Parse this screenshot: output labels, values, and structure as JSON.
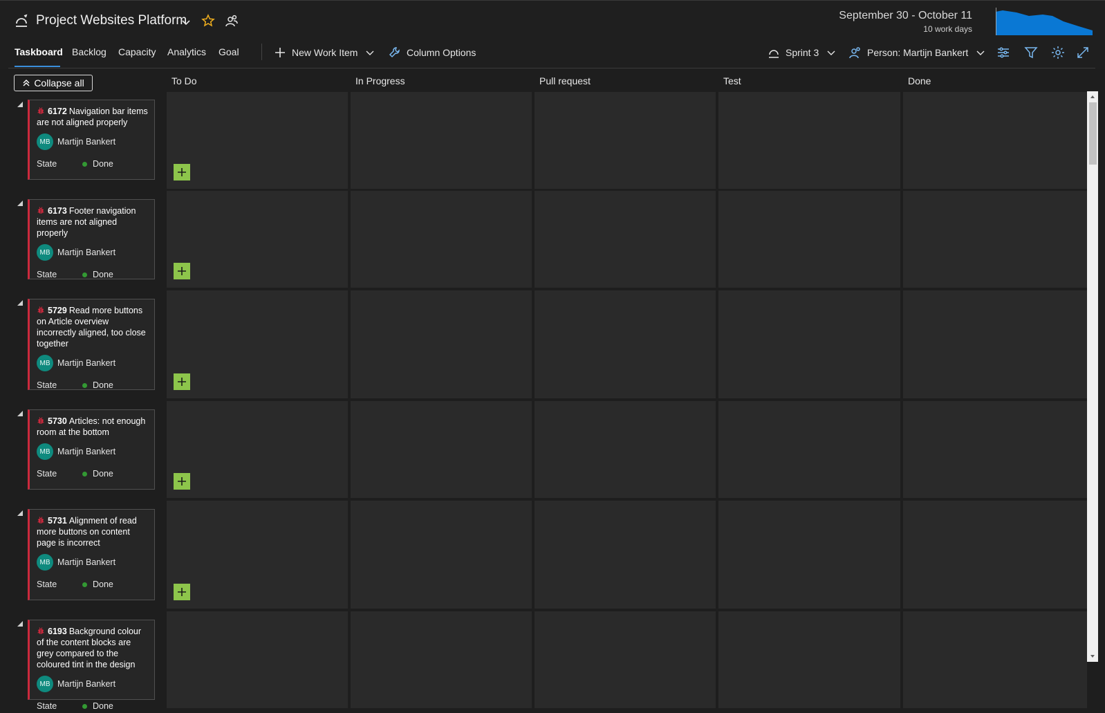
{
  "header": {
    "project_title": "Project Websites Platform",
    "sprint_range": "September 30 - October 11",
    "work_days": "10 work days"
  },
  "tabs": [
    {
      "label": "Taskboard",
      "active": true
    },
    {
      "label": "Backlog"
    },
    {
      "label": "Capacity"
    },
    {
      "label": "Analytics"
    },
    {
      "label": "Goal"
    }
  ],
  "toolbar": {
    "new_work_item": "New Work Item",
    "column_options": "Column Options",
    "sprint_selector": "Sprint 3",
    "person_filter": "Person: Martijn Bankert"
  },
  "board": {
    "collapse_all": "Collapse all",
    "columns": [
      "To Do",
      "In Progress",
      "Pull request",
      "Test",
      "Done"
    ],
    "state_label": "State",
    "items": [
      {
        "id": "6172",
        "title": "Navigation bar items are not aligned properly",
        "assignee": "Martijn Bankert",
        "initials": "MB",
        "state": "Done"
      },
      {
        "id": "6173",
        "title": "Footer navigation items are not aligned properly",
        "assignee": "Martijn Bankert",
        "initials": "MB",
        "state": "Done"
      },
      {
        "id": "5729",
        "title": "Read more buttons on Article overview incorrectly aligned, too close together",
        "assignee": "Martijn Bankert",
        "initials": "MB",
        "state": "Done"
      },
      {
        "id": "5730",
        "title": "Articles: not enough room at the bottom",
        "assignee": "Martijn Bankert",
        "initials": "MB",
        "state": "Done"
      },
      {
        "id": "5731",
        "title": "Alignment of read more buttons on content page is incorrect",
        "assignee": "Martijn Bankert",
        "initials": "MB",
        "state": "Done"
      },
      {
        "id": "6193",
        "title": "Background colour of the content blocks are grey compared to the coloured tint in the design",
        "assignee": "Martijn Bankert",
        "initials": "MB",
        "state": "Done"
      }
    ]
  },
  "colors": {
    "accent": "#3b8fdc",
    "bug_border": "#cc293d",
    "add_button": "#8dc54b",
    "avatar": "#0f8a7e",
    "done_dot": "#339933",
    "burndown": "#0a78d4"
  }
}
